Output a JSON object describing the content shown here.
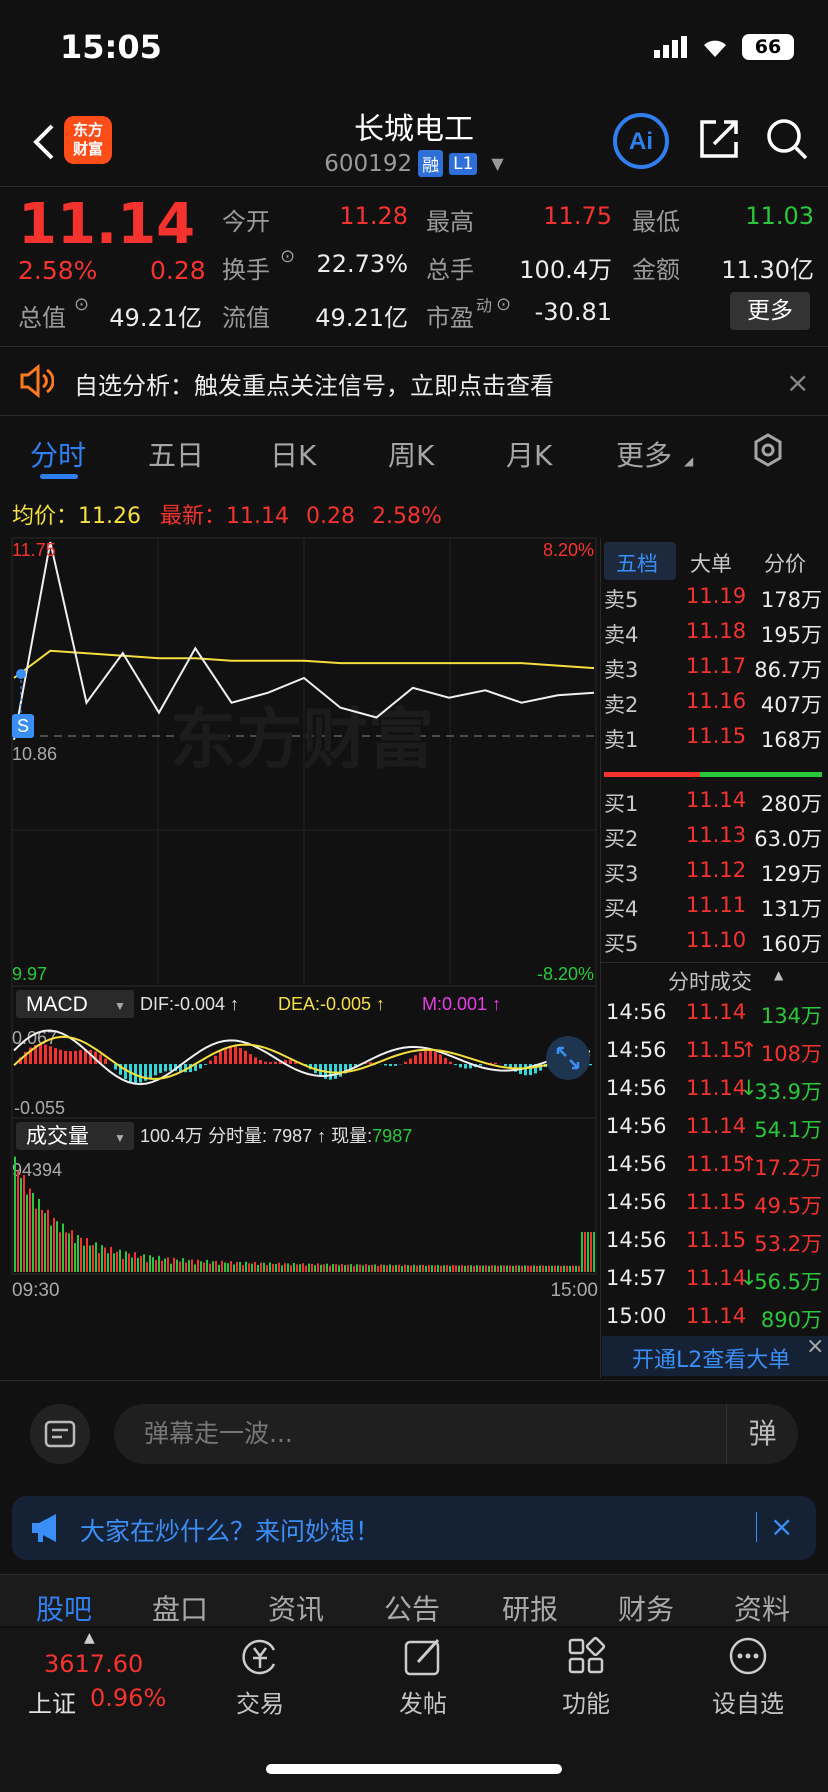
{
  "status": {
    "time": "15:05",
    "battery": "66"
  },
  "header": {
    "logo": [
      "东方",
      "财富"
    ],
    "stock_name": "长城电工",
    "stock_code": "600192",
    "tag_margin": "融",
    "tag_level": "L1"
  },
  "quote": {
    "price": "11.14",
    "change_pct": "2.58%",
    "change": "0.28",
    "open_label": "今开",
    "open": "11.28",
    "high_label": "最高",
    "high": "11.75",
    "low_label": "最低",
    "low": "11.03",
    "turnover_label": "换手",
    "turnover": "22.73%",
    "volume_label": "总手",
    "volume": "100.4万",
    "amount_label": "金额",
    "amount": "11.30亿",
    "mktcap_label": "总值",
    "mktcap": "49.21亿",
    "float_label": "流值",
    "float": "49.21亿",
    "pe_label": "市盈",
    "pe_sup": "动",
    "pe": "-30.81",
    "more": "更多"
  },
  "alert": {
    "text": "自选分析：触发重点关注信号，立即点击查看"
  },
  "chart_tabs": [
    "分时",
    "五日",
    "日K",
    "周K",
    "月K",
    "更多"
  ],
  "avg_row": {
    "avg_label": "均价：",
    "avg": "11.26",
    "latest_label": "最新：",
    "latest": "11.14",
    "change": "0.28",
    "pct": "2.58%"
  },
  "price_chart": {
    "y_top": "11.75",
    "y_mid": "10.86",
    "y_bot": "9.97",
    "pct_top": "8.20%",
    "pct_bot": "-8.20%",
    "marker": "S",
    "watermark": "东方财富"
  },
  "chart_data": [
    {
      "type": "line",
      "x": [
        "09:30",
        "15:00"
      ],
      "series": [
        {
          "values": [
            10.95,
            11.75,
            11.1,
            11.3,
            11.06,
            11.32,
            11.1,
            11.14,
            11.2,
            11.08,
            11.04,
            11.16,
            11.12,
            11.15,
            11.1,
            11.13,
            11.14
          ]
        },
        {
          "values": [
            11.2,
            11.31,
            11.3,
            11.29,
            11.28,
            11.28,
            11.27,
            11.27,
            11.27,
            11.26,
            11.26,
            11.26,
            11.26,
            11.26,
            11.26,
            11.25,
            11.24
          ]
        }
      ],
      "ylim": [
        9.97,
        11.75
      ]
    }
  ],
  "macd": {
    "label": "MACD",
    "dif_label": "DIF:",
    "dif": "-0.004 ↑",
    "dea_label": "DEA:",
    "dea": "-0.005 ↑",
    "m_label": "M:",
    "m": "0.001 ↑",
    "y_top": "0.067",
    "y_bot": "-0.055"
  },
  "volume": {
    "label": "成交量",
    "total": "100.4万",
    "per_label": "分时量:",
    "per": "7987 ↑",
    "now_label": "现量:",
    "now": "7987",
    "y_top": "94394",
    "x_start": "09:30",
    "x_end": "15:00"
  },
  "orderbook": {
    "tabs": [
      "五档",
      "大单",
      "分价"
    ],
    "asks": [
      {
        "label": "卖5",
        "price": "11.19",
        "vol": "178万"
      },
      {
        "label": "卖4",
        "price": "11.18",
        "vol": "195万"
      },
      {
        "label": "卖3",
        "price": "11.17",
        "vol": "86.7万"
      },
      {
        "label": "卖2",
        "price": "11.16",
        "vol": "407万"
      },
      {
        "label": "卖1",
        "price": "11.15",
        "vol": "168万"
      }
    ],
    "bids": [
      {
        "label": "买1",
        "price": "11.14",
        "vol": "280万"
      },
      {
        "label": "买2",
        "price": "11.13",
        "vol": "63.0万"
      },
      {
        "label": "买3",
        "price": "11.12",
        "vol": "129万"
      },
      {
        "label": "买4",
        "price": "11.11",
        "vol": "131万"
      },
      {
        "label": "买5",
        "price": "11.10",
        "vol": "160万"
      }
    ],
    "ticks_title": "分时成交",
    "ticks": [
      {
        "time": "14:56",
        "price": "11.14",
        "arrow": "",
        "vol": "134万",
        "c": "green"
      },
      {
        "time": "14:56",
        "price": "11.15",
        "arrow": "↑",
        "vol": "108万",
        "c": "red"
      },
      {
        "time": "14:56",
        "price": "11.14",
        "arrow": "↓",
        "vol": "33.9万",
        "c": "green"
      },
      {
        "time": "14:56",
        "price": "11.14",
        "arrow": "",
        "vol": "54.1万",
        "c": "green"
      },
      {
        "time": "14:56",
        "price": "11.15",
        "arrow": "↑",
        "vol": "17.2万",
        "c": "red"
      },
      {
        "time": "14:56",
        "price": "11.15",
        "arrow": "",
        "vol": "49.5万",
        "c": "red"
      },
      {
        "time": "14:56",
        "price": "11.15",
        "arrow": "",
        "vol": "53.2万",
        "c": "red"
      },
      {
        "time": "14:57",
        "price": "11.14",
        "arrow": "↓",
        "vol": "56.5万",
        "c": "green"
      },
      {
        "time": "15:00",
        "price": "11.14",
        "arrow": "",
        "vol": "890万",
        "c": "green"
      }
    ],
    "l2_promo": "开通L2查看大单"
  },
  "danmu": {
    "placeholder": "弹幕走一波...",
    "send": "弹"
  },
  "ask_bar": {
    "text": "大家在炒什么？来问妙想！"
  },
  "bottom_tabs": [
    "股吧",
    "盘口",
    "资讯",
    "公告",
    "研报",
    "财务",
    "资料"
  ],
  "nav": {
    "index_value": "3617.60",
    "index_name": "上证",
    "index_pct": "0.96%",
    "items": [
      "交易",
      "发帖",
      "功能",
      "设自选"
    ]
  },
  "colors": {
    "up": "#f5332e",
    "down": "#29c83a",
    "accent": "#2f7ff0",
    "avg_line": "#f4df3c"
  }
}
